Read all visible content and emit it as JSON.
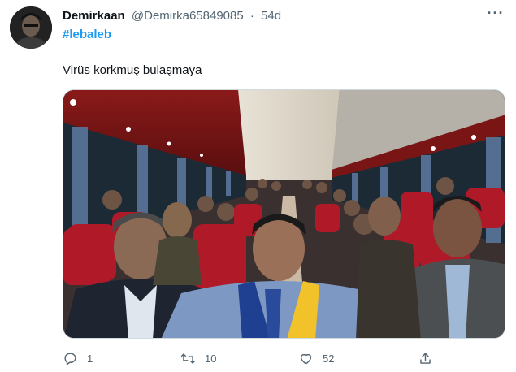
{
  "author": {
    "display_name": "Demirkaan",
    "handle": "@Demirka65849085",
    "separator": "·",
    "time": "54d",
    "avatar_icon": "user-avatar"
  },
  "hashtag": "#lebaleb",
  "text": "Virüs korkmuş bulaşmaya",
  "media": {
    "description_icon": "photo-bus-interior"
  },
  "actions": {
    "reply_count": "1",
    "retweet_count": "10",
    "like_count": "52"
  },
  "colors": {
    "link": "#1d9bf0",
    "muted": "#536471",
    "text": "#0f1419"
  }
}
